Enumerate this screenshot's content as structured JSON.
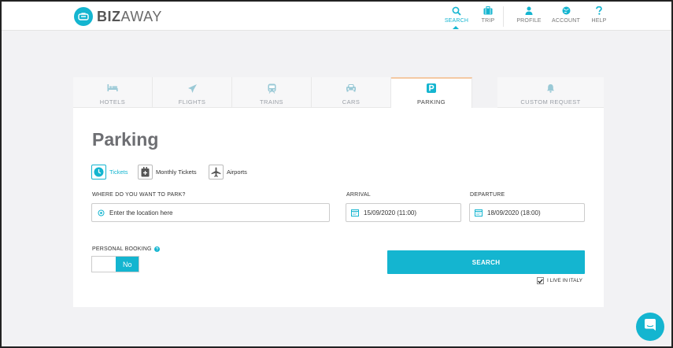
{
  "brand": {
    "name_bold": "BIZ",
    "name_light": "AWAY"
  },
  "nav": [
    {
      "label": "SEARCH",
      "icon": "search-icon",
      "active": true
    },
    {
      "label": "TRIP",
      "icon": "suitcase-icon",
      "active": false
    },
    {
      "label": "PROFILE",
      "icon": "user-icon",
      "active": false
    },
    {
      "label": "ACCOUNT",
      "icon": "globe-icon",
      "active": false
    },
    {
      "label": "HELP",
      "icon": "question-icon",
      "active": false
    }
  ],
  "tabs": [
    {
      "label": "HOTELS",
      "icon": "bed-icon"
    },
    {
      "label": "FLIGHTS",
      "icon": "plane-icon"
    },
    {
      "label": "TRAINS",
      "icon": "train-icon"
    },
    {
      "label": "CARS",
      "icon": "car-icon"
    },
    {
      "label": "PARKING",
      "icon": "parking-icon",
      "active": true
    },
    {
      "label": "CUSTOM REQUEST",
      "icon": "bell-icon"
    }
  ],
  "page": {
    "title": "Parking"
  },
  "types": [
    {
      "label": "Tickets",
      "icon": "clock-icon",
      "active": true
    },
    {
      "label": "Monthly Tickets",
      "icon": "calendar-badge-icon"
    },
    {
      "label": "Airports",
      "icon": "airplane-icon"
    }
  ],
  "form": {
    "location_label": "WHERE DO YOU WANT TO PARK?",
    "location_placeholder": "Enter the location here",
    "arrival_label": "ARRIVAL",
    "arrival_value": "15/09/2020 (11:00)",
    "departure_label": "DEPARTURE",
    "departure_value": "18/09/2020 (18:00)",
    "personal_booking_label": "PERSONAL BOOKING",
    "personal_booking_value": "No",
    "search_label": "SEARCH",
    "italy_label": "I LIVE IN ITALY",
    "italy_checked": true
  },
  "colors": {
    "accent": "#14b5d0",
    "tab_active_border": "#f4c9a3"
  }
}
